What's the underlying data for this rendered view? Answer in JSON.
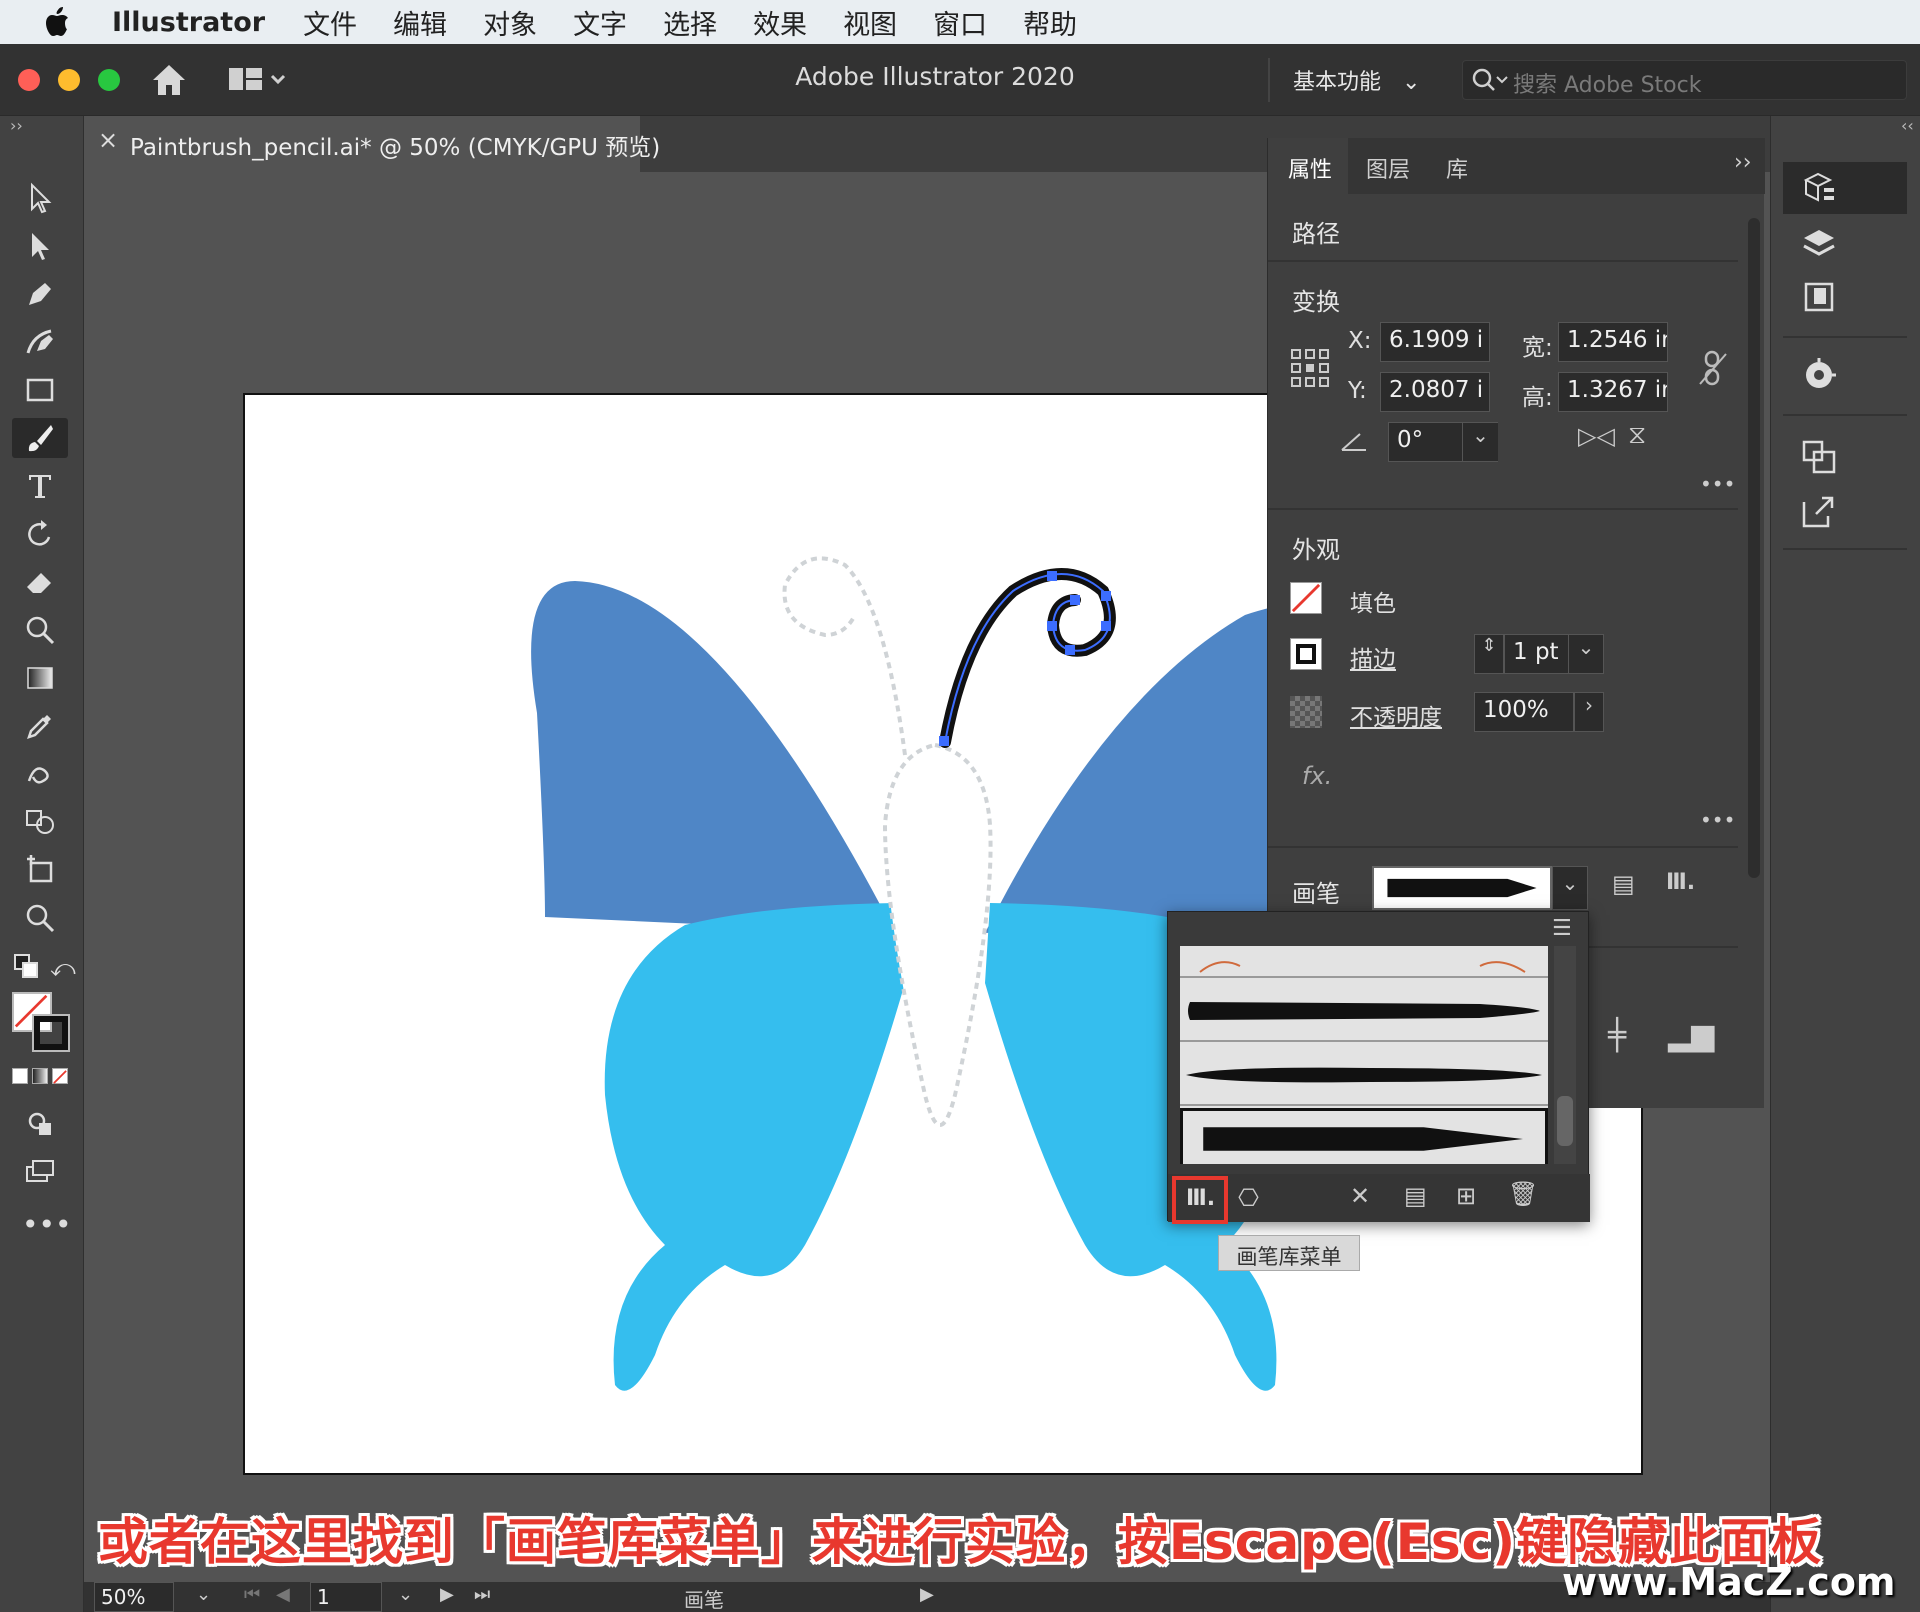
{
  "menubar": {
    "app_name": "Illustrator",
    "items": [
      "文件",
      "编辑",
      "对象",
      "文字",
      "选择",
      "效果",
      "视图",
      "窗口",
      "帮助"
    ]
  },
  "titlebar": {
    "title": "Adobe Illustrator 2020",
    "workspace": "基本功能",
    "stock_placeholder": "搜索 Adobe Stock"
  },
  "document": {
    "tab_title": "Paintbrush_pencil.ai* @ 50% (CMYK/GPU 预览)",
    "close": "×"
  },
  "properties": {
    "tabs": [
      "属性",
      "图层",
      "库"
    ],
    "object_type": "路径",
    "transform": {
      "title": "变换",
      "x_label": "X:",
      "x_value": "6.1909 i",
      "y_label": "Y:",
      "y_value": "2.0807 i",
      "w_label": "宽:",
      "w_value": "1.2546 ir",
      "h_label": "高:",
      "h_value": "1.3267 ir",
      "angle_value": "0°"
    },
    "appearance": {
      "title": "外观",
      "fill_label": "填色",
      "stroke_label": "描边",
      "stroke_value": "1 pt",
      "opacity_label": "不透明度",
      "opacity_value": "100%",
      "fx_label": "fx."
    },
    "brush": {
      "label": "画笔"
    }
  },
  "flyout": {
    "tooltip": "画笔库菜单"
  },
  "statusbar": {
    "zoom": "50%",
    "page": "1",
    "tool_name": "画笔"
  },
  "caption": "或者在这里找到「画笔库菜单」来进行实验，按Escape(Esc)键隐藏此面板",
  "watermark": "www.MacZ.com",
  "colors": {
    "wing_top": "#4f86c6",
    "wing_bottom": "#35beee",
    "highlight": "#e8382e",
    "selection": "#3c6dff"
  }
}
